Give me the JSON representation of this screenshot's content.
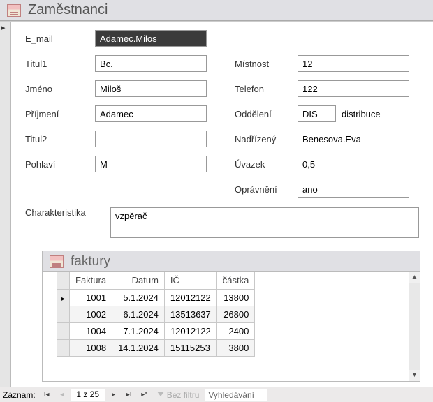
{
  "header": {
    "title": "Zaměstnanci"
  },
  "labels": {
    "email": "E_mail",
    "titul1": "Titul1",
    "jmeno": "Jméno",
    "prijmeni": "Příjmení",
    "titul2": "Titul2",
    "pohlavi": "Pohlaví",
    "mistnost": "Místnost",
    "telefon": "Telefon",
    "oddeleni": "Oddělení",
    "nadrizeny": "Nadřízený",
    "uvazek": "Úvazek",
    "opravneni": "Oprávnění",
    "charak": "Charakteristika"
  },
  "values": {
    "email": "Adamec.Milos",
    "titul1": "Bc.",
    "jmeno": "Miloš",
    "prijmeni": "Adamec",
    "titul2": "",
    "pohlavi": "M",
    "mistnost": "12",
    "telefon": "122",
    "oddeleni_code": "DIS",
    "oddeleni_name": "distribuce",
    "nadrizeny": "Benesova.Eva",
    "uvazek": "0,5",
    "opravneni": "ano",
    "charak": "vzpěrač"
  },
  "subform": {
    "title": "faktury",
    "columns": {
      "faktura": "Faktura",
      "datum": "Datum",
      "ic": "IČ",
      "castka": "částka"
    },
    "rows": [
      {
        "faktura": "1001",
        "datum": "5.1.2024",
        "ic": "12012122",
        "castka": "13800"
      },
      {
        "faktura": "1002",
        "datum": "6.1.2024",
        "ic": "13513637",
        "castka": "26800"
      },
      {
        "faktura": "1004",
        "datum": "7.1.2024",
        "ic": "12012122",
        "castka": "2400"
      },
      {
        "faktura": "1008",
        "datum": "14.1.2024",
        "ic": "15115253",
        "castka": "3800"
      }
    ]
  },
  "nav": {
    "label": "Záznam:",
    "position": "1 z 25",
    "filter": "Bez filtru",
    "search": "Vyhledávání"
  }
}
